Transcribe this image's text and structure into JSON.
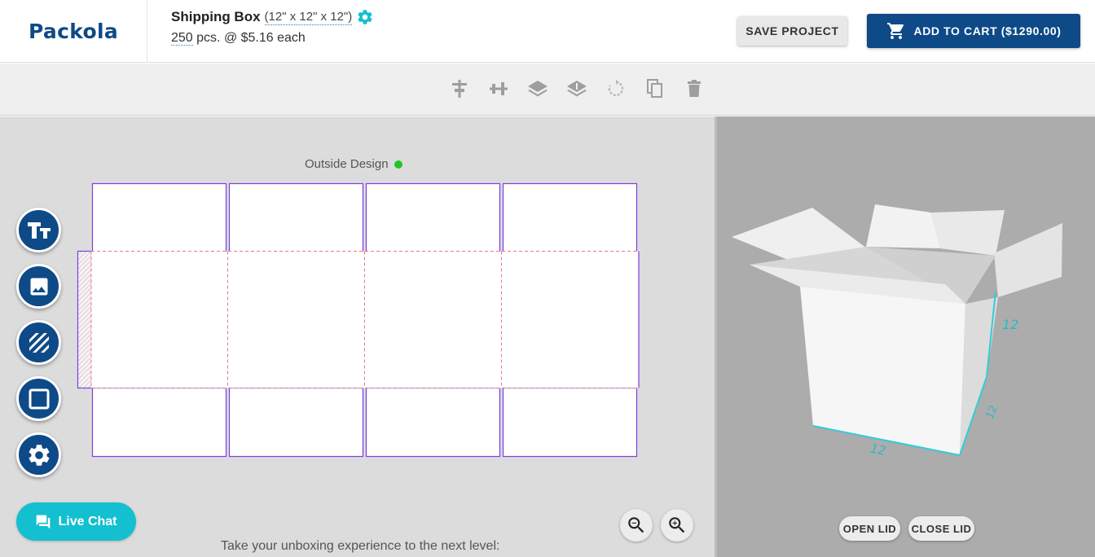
{
  "header": {
    "logo": "Packola",
    "product_name": "Shipping Box",
    "product_dims": "(12\" x 12\" x 12\")",
    "quantity": "250",
    "quantity_suffix": " pcs. @ $5.16 each",
    "save_label": "SAVE PROJECT",
    "cart_label": "ADD TO CART ($1290.00)"
  },
  "toolbar": {
    "tools": [
      "align-top-icon",
      "align-center-icon",
      "bring-forward-icon",
      "send-backward-icon",
      "rotate-icon",
      "duplicate-icon",
      "delete-icon"
    ]
  },
  "editor": {
    "side_label": "Outside Design",
    "side_status_color": "#22c422",
    "side_buttons": [
      "text-icon",
      "image-icon",
      "pattern-icon",
      "shape-icon",
      "settings-icon"
    ],
    "live_chat": "Live Chat",
    "promo_text": "Take your unboxing experience to the next level:"
  },
  "preview": {
    "dimension_labels": [
      "12",
      "12",
      "12"
    ],
    "open_lid": "OPEN LID",
    "close_lid": "CLOSE LID"
  },
  "colors": {
    "brand": "#0d4a87",
    "accent": "#14bfd0",
    "dieline_cut": "#7b3fe4",
    "dieline_fold": "#e57a8a"
  }
}
